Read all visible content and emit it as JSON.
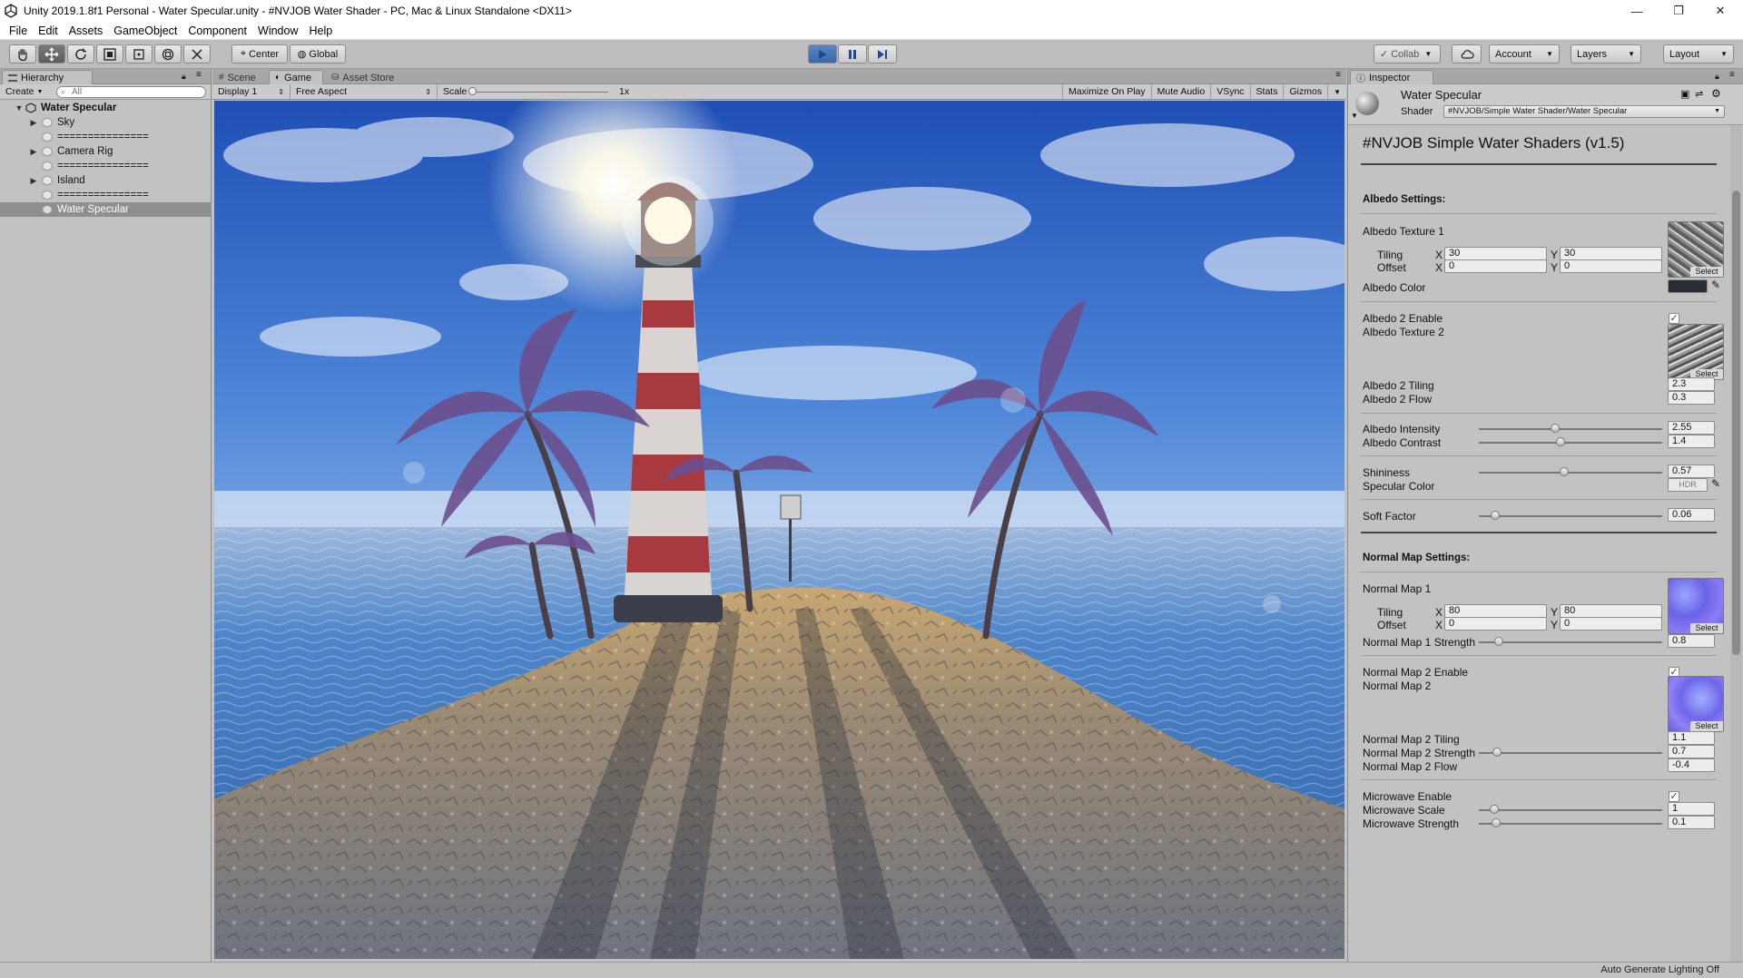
{
  "window": {
    "title": "Unity 2019.1.8f1 Personal - Water Specular.unity - #NVJOB Water Shader - PC, Mac & Linux Standalone <DX11>",
    "controls": [
      "—",
      "❐",
      "✕"
    ]
  },
  "menu": [
    "File",
    "Edit",
    "Assets",
    "GameObject",
    "Component",
    "Window",
    "Help"
  ],
  "toolbar": {
    "pivot_label": "Center",
    "space_label": "Global",
    "collab_label": "Collab",
    "account_label": "Account",
    "layers_label": "Layers",
    "layout_label": "Layout",
    "play_active": true
  },
  "hierarchy": {
    "tab_label": "Hierarchy",
    "create_label": "Create",
    "search_placeholder": "All",
    "scene_name": "Water Specular",
    "items": [
      {
        "label": "Sky",
        "has_children": true
      },
      {
        "label": "===============",
        "has_children": false
      },
      {
        "label": "Camera Rig",
        "has_children": true
      },
      {
        "label": "===============",
        "has_children": false
      },
      {
        "label": "Island",
        "has_children": true
      },
      {
        "label": "===============",
        "has_children": false
      },
      {
        "label": "Water Specular",
        "has_children": false,
        "selected": true
      }
    ]
  },
  "game": {
    "tabs": [
      "Scene",
      "Game",
      "Asset Store"
    ],
    "active_tab": "Game",
    "display": "Display 1",
    "aspect": "Free Aspect",
    "scale_label": "Scale",
    "scale_value": "1x",
    "buttons": [
      "Maximize On Play",
      "Mute Audio",
      "VSync",
      "Stats",
      "Gizmos"
    ]
  },
  "inspector": {
    "tab_label": "Inspector",
    "material_name": "Water Specular",
    "shader_label": "Shader",
    "shader_value": "#NVJOB/Simple Water Shader/Water Specular",
    "header_title": "#NVJOB Simple Water Shaders (v1.5)",
    "albedo_section": "Albedo Settings:",
    "albedo_tex1": "Albedo Texture 1",
    "tiling_label": "Tiling",
    "offset_label": "Offset",
    "x_label": "X",
    "y_label": "Y",
    "albedo_tiling_x": "30",
    "albedo_tiling_y": "30",
    "albedo_offset_x": "0",
    "albedo_offset_y": "0",
    "select_label": "Select",
    "albedo_color": "Albedo Color",
    "albedo2_enable": "Albedo 2 Enable",
    "albedo_tex2": "Albedo Texture 2",
    "albedo2_tiling_label": "Albedo 2 Tiling",
    "albedo2_tiling": "2.3",
    "albedo2_flow_label": "Albedo 2 Flow",
    "albedo2_flow": "0.3",
    "albedo_intensity_label": "Albedo Intensity",
    "albedo_intensity": "2.55",
    "albedo_contrast_label": "Albedo Contrast",
    "albedo_contrast": "1.4",
    "shininess_label": "Shininess",
    "shininess": "0.57",
    "specular_color_label": "Specular Color",
    "hdr_label": "HDR",
    "soft_factor_label": "Soft Factor",
    "soft_factor": "0.06",
    "normal_section": "Normal Map Settings:",
    "normal_map1": "Normal Map 1",
    "normal_tiling_x": "80",
    "normal_tiling_y": "80",
    "normal_offset_x": "0",
    "normal_offset_y": "0",
    "normal1_strength_label": "Normal Map 1 Strength",
    "normal1_strength": "0.8",
    "normal2_enable": "Normal Map 2 Enable",
    "normal_map2": "Normal Map 2",
    "normal2_tiling_label": "Normal Map 2 Tiling",
    "normal2_tiling": "1.1",
    "normal2_strength_label": "Normal Map 2 Strength",
    "normal2_strength": "0.7",
    "normal2_flow_label": "Normal Map 2 Flow",
    "normal2_flow": "-0.4",
    "microwave_enable": "Microwave Enable",
    "microwave_scale_label": "Microwave Scale",
    "microwave_scale": "1",
    "microwave_strength_label": "Microwave Strength",
    "microwave_strength": "0.1"
  },
  "status": {
    "right_text": "Auto Generate Lighting Off"
  },
  "colors": {
    "editor_bg": "#c2c2c2",
    "play_blue": "#3c67a8",
    "sky_top": "#2b5fc4",
    "ocean": "#4a82c8"
  }
}
